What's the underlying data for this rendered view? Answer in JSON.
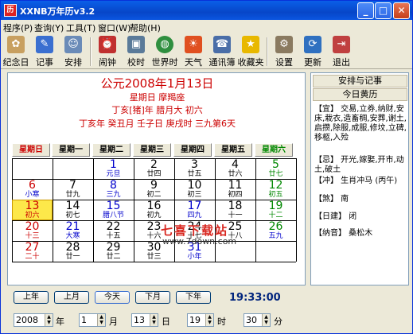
{
  "window": {
    "title": "XXNB万年历v3.2",
    "icon": "app-calendar-icon"
  },
  "menu": [
    "程序(P)",
    "查询(Y)",
    "工具(T)",
    "窗口(W)",
    "帮助(H)"
  ],
  "toolbar": [
    "纪念日",
    "记事",
    "安排",
    "闹钟",
    "校时",
    "世界时",
    "天气",
    "通讯簿",
    "收藏夹",
    "设置",
    "更新",
    "退出"
  ],
  "header": {
    "solar": "公元2008年1月13日",
    "week_zodiac": "星期日 摩羯座",
    "lunar": "丁亥[猪]年 腊月大 初六",
    "ganzhi": "丁亥年 癸丑月 壬子日 庚戌时 三九第6天"
  },
  "weekdays": [
    "星期日",
    "星期一",
    "星期二",
    "星期三",
    "星期四",
    "星期五",
    "星期六"
  ],
  "calendar_rows": [
    [
      [
        "",
        ""
      ],
      [
        "",
        ""
      ],
      [
        "1",
        "元旦"
      ],
      [
        "2",
        "廿四"
      ],
      [
        "3",
        "廿五"
      ],
      [
        "4",
        "廿六"
      ],
      [
        "5",
        "廿七"
      ]
    ],
    [
      [
        "6",
        "小寒"
      ],
      [
        "7",
        "廿九"
      ],
      [
        "8",
        "三九"
      ],
      [
        "9",
        "初二"
      ],
      [
        "10",
        "初三"
      ],
      [
        "11",
        "初四"
      ],
      [
        "12",
        "初五"
      ]
    ],
    [
      [
        "13",
        "初六"
      ],
      [
        "14",
        "初七"
      ],
      [
        "15",
        "腊八节"
      ],
      [
        "16",
        "初九"
      ],
      [
        "17",
        "四九"
      ],
      [
        "18",
        "十一"
      ],
      [
        "19",
        "十二"
      ]
    ],
    [
      [
        "20",
        "十三"
      ],
      [
        "21",
        "大寒"
      ],
      [
        "22",
        "十五"
      ],
      [
        "23",
        "十六"
      ],
      [
        "24",
        "十七"
      ],
      [
        "25",
        "十八"
      ],
      [
        "26",
        "五九"
      ]
    ],
    [
      [
        "27",
        "二十"
      ],
      [
        "28",
        "廿一"
      ],
      [
        "29",
        "廿二"
      ],
      [
        "30",
        "廿三"
      ],
      [
        "31",
        "小年"
      ],
      [
        "",
        ""
      ],
      [
        "",
        ""
      ]
    ]
  ],
  "side": {
    "btn1": "安排与记事",
    "btn2": "今日黄历",
    "yi": "【宜】 交易,立券,纳财,安床,栽衣,造畜稠,安葬,谢土,启攒,除服,成服,修坟,立碑,移柩,入殓",
    "ji": "【忌】 开光,嫁娶,开市,动土,破土",
    "chong": "【冲】 生肖冲马 (丙午)",
    "sha": "【煞】 南",
    "rijian": "【日建】 闭",
    "nayin": "【纳音】 桑松木"
  },
  "watermark": {
    "cn": "七喜下载站",
    "url": "www.7down.com"
  },
  "nav": [
    "上年",
    "上月",
    "今天",
    "下月",
    "下年"
  ],
  "clock": "19:33:00",
  "fields": {
    "year": "2008",
    "month": "1",
    "day": "13",
    "hour": "19",
    "minute": "30"
  },
  "units": {
    "year": "年",
    "month": "月",
    "day": "日",
    "hour": "时",
    "minute": "分"
  }
}
